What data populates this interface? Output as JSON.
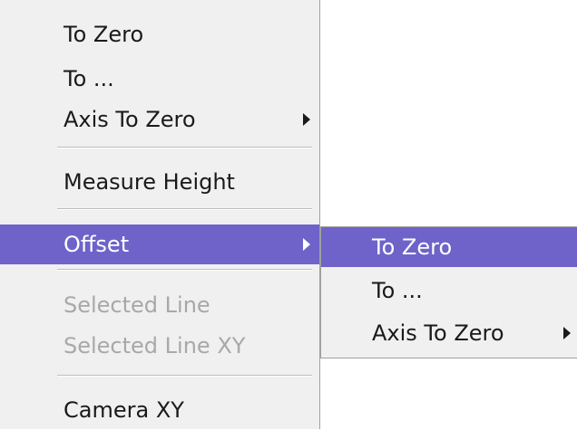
{
  "main_menu": {
    "items": [
      {
        "label": "To Zero"
      },
      {
        "label": "To ..."
      },
      {
        "label": "Axis To Zero",
        "has_submenu": true
      },
      {
        "label": "Measure Height"
      },
      {
        "label": "Offset",
        "has_submenu": true,
        "active": true
      },
      {
        "label": "Selected Line",
        "disabled": true
      },
      {
        "label": "Selected Line XY",
        "disabled": true
      },
      {
        "label": "Camera XY"
      }
    ]
  },
  "submenu": {
    "parent": "Offset",
    "items": [
      {
        "label": "To Zero",
        "active": true
      },
      {
        "label": "To ..."
      },
      {
        "label": "Axis To Zero",
        "has_submenu": true
      }
    ]
  },
  "colors": {
    "menu_background": "#f0f0f0",
    "highlight": "#6f63c9",
    "highlight_text": "#ffffff",
    "disabled_text": "#a8a8a8",
    "text": "#1a1a1a"
  }
}
